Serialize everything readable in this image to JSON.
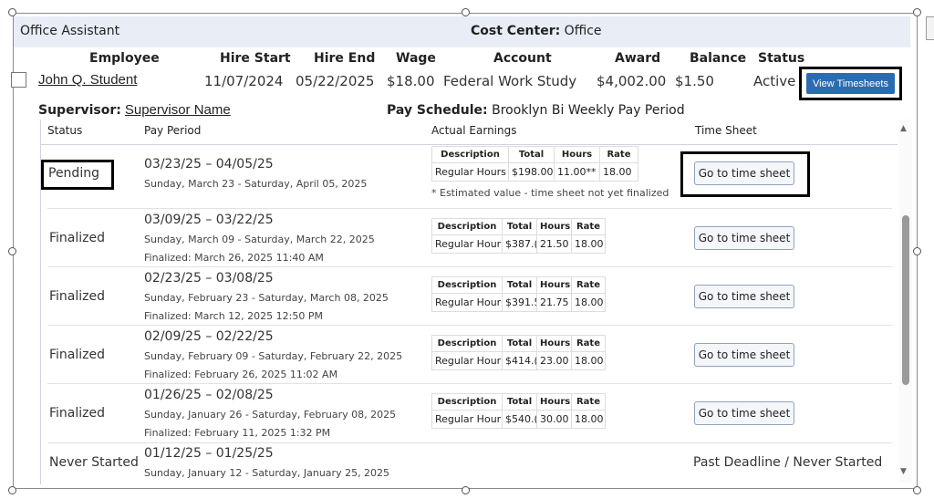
{
  "header": {
    "title": "Office Assistant",
    "cost_center_label": "Cost Center:",
    "cost_center_value": "Office"
  },
  "columns": {
    "employee": "Employee",
    "hire_start": "Hire Start",
    "hire_end": "Hire End",
    "wage": "Wage",
    "account": "Account",
    "award": "Award",
    "balance": "Balance",
    "status": "Status"
  },
  "employee_row": {
    "name": "John Q. Student",
    "hire_start": "11/07/2024",
    "hire_end": "05/22/2025",
    "wage": "$18.00",
    "account": "Federal Work Study",
    "award": "$4,002.00",
    "balance": "$1.50",
    "status": "Active",
    "view_button": "View Timesheets"
  },
  "supervisor": {
    "label": "Supervisor:",
    "name": "Supervisor Name"
  },
  "pay_schedule": {
    "label": "Pay Schedule:",
    "value": "Brooklyn Bi Weekly Pay Period"
  },
  "grid_headers": {
    "status": "Status",
    "pay_period": "Pay Period",
    "actual_earnings": "Actual Earnings",
    "time_sheet": "Time Sheet"
  },
  "mini_headers": {
    "description": "Description",
    "total": "Total",
    "hours": "Hours",
    "rate": "Rate"
  },
  "rows": [
    {
      "status": "Pending",
      "period": "03/23/25 – 04/05/25",
      "dates": "Sunday, March 23 - Saturday, April 05, 2025",
      "finalized": "",
      "earn": {
        "description": "Regular Hours",
        "total": "$198.00",
        "hours": "11.00**",
        "rate": "18.00"
      },
      "note": "* Estimated value - time sheet not yet finalized",
      "action": "Go to time sheet"
    },
    {
      "status": "Finalized",
      "period": "03/09/25 – 03/22/25",
      "dates": "Sunday, March 09 - Saturday, March 22, 2025",
      "finalized": "Finalized: March 26, 2025 11:40 AM",
      "earn": {
        "description": "Regular Hour",
        "total": "$387.(",
        "hours": "21.50",
        "rate": "18.00"
      },
      "action": "Go to time sheet"
    },
    {
      "status": "Finalized",
      "period": "02/23/25 – 03/08/25",
      "dates": "Sunday, February 23 - Saturday, March 08, 2025",
      "finalized": "Finalized: March 12, 2025 12:50 PM",
      "earn": {
        "description": "Regular Hour",
        "total": "$391.5",
        "hours": "21.75",
        "rate": "18.00"
      },
      "action": "Go to time sheet"
    },
    {
      "status": "Finalized",
      "period": "02/09/25 – 02/22/25",
      "dates": "Sunday, February 09 - Saturday, February 22, 2025",
      "finalized": "Finalized: February 26, 2025 11:02 AM",
      "earn": {
        "description": "Regular Hour",
        "total": "$414.(",
        "hours": "23.00",
        "rate": "18.00"
      },
      "action": "Go to time sheet"
    },
    {
      "status": "Finalized",
      "period": "01/26/25 – 02/08/25",
      "dates": "Sunday, January 26 - Saturday, February 08, 2025",
      "finalized": "Finalized: February 11, 2025 1:32 PM",
      "earn": {
        "description": "Regular Hour",
        "total": "$540.(",
        "hours": "30.00",
        "rate": "18.00"
      },
      "action": "Go to time sheet"
    },
    {
      "status": "Never Started",
      "period": "01/12/25 – 01/25/25",
      "dates": "Sunday, January 12 - Saturday, January 25, 2025",
      "finalized": "",
      "action_text": "Past Deadline / Never Started"
    }
  ],
  "colors": {
    "accent": "#2b6cb0",
    "header_bg": "#e8edf6",
    "highlight": "#000000"
  }
}
